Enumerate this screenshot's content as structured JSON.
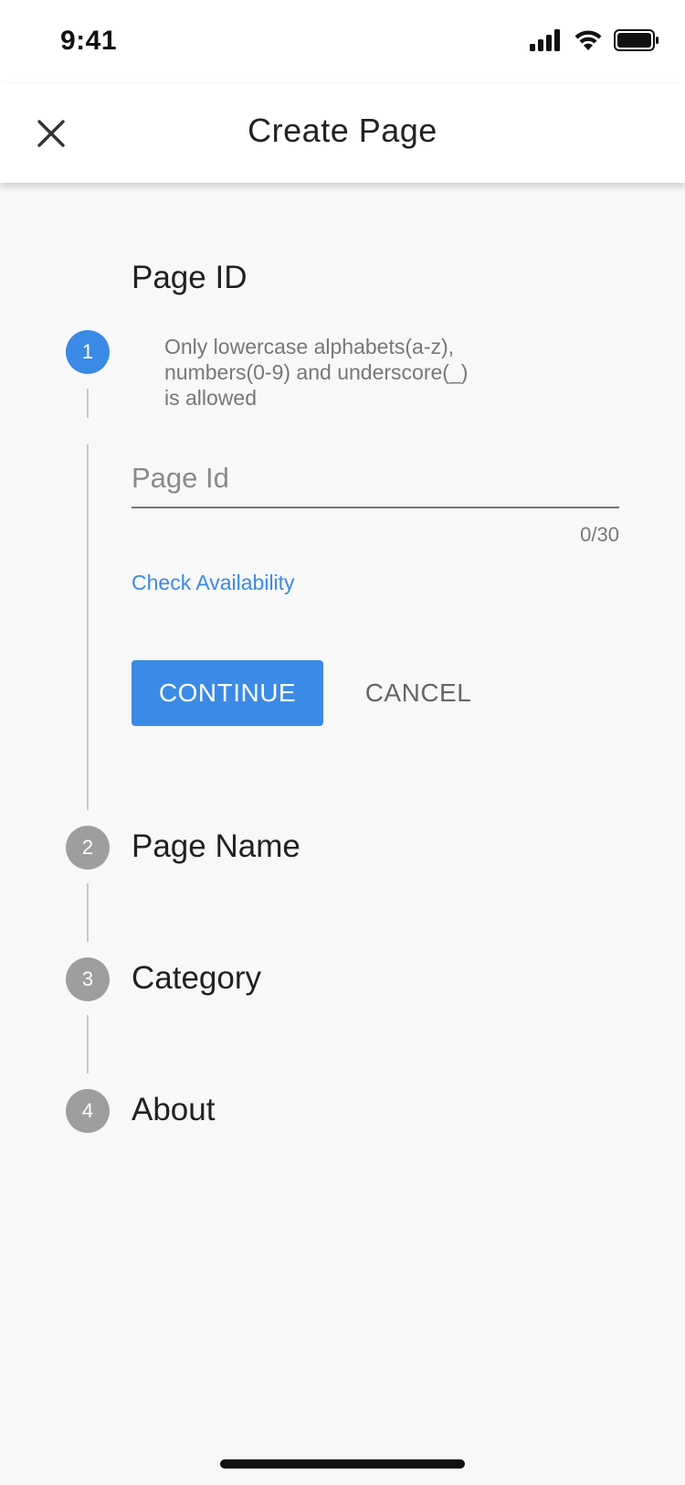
{
  "status_bar": {
    "time": "9:41"
  },
  "app_bar": {
    "title": "Create Page",
    "close_icon": "close-icon"
  },
  "stepper": {
    "steps": [
      {
        "number": "1",
        "title": "Page ID",
        "state": "active"
      },
      {
        "number": "2",
        "title": "Page Name",
        "state": "inactive"
      },
      {
        "number": "3",
        "title": "Category",
        "state": "inactive"
      },
      {
        "number": "4",
        "title": "About",
        "state": "inactive"
      }
    ],
    "active_step": {
      "subtitle": "Only lowercase alphabets(a-z), numbers(0-9) and underscore(_) is allowed",
      "input": {
        "value": "",
        "placeholder": "Page Id"
      },
      "counter": "0/30",
      "check_link": "Check Availability",
      "continue_label": "CONTINUE",
      "cancel_label": "CANCEL"
    }
  },
  "colors": {
    "accent": "#3b8ae6",
    "inactive_step": "#9e9e9e",
    "background": "#f8f8f8"
  }
}
